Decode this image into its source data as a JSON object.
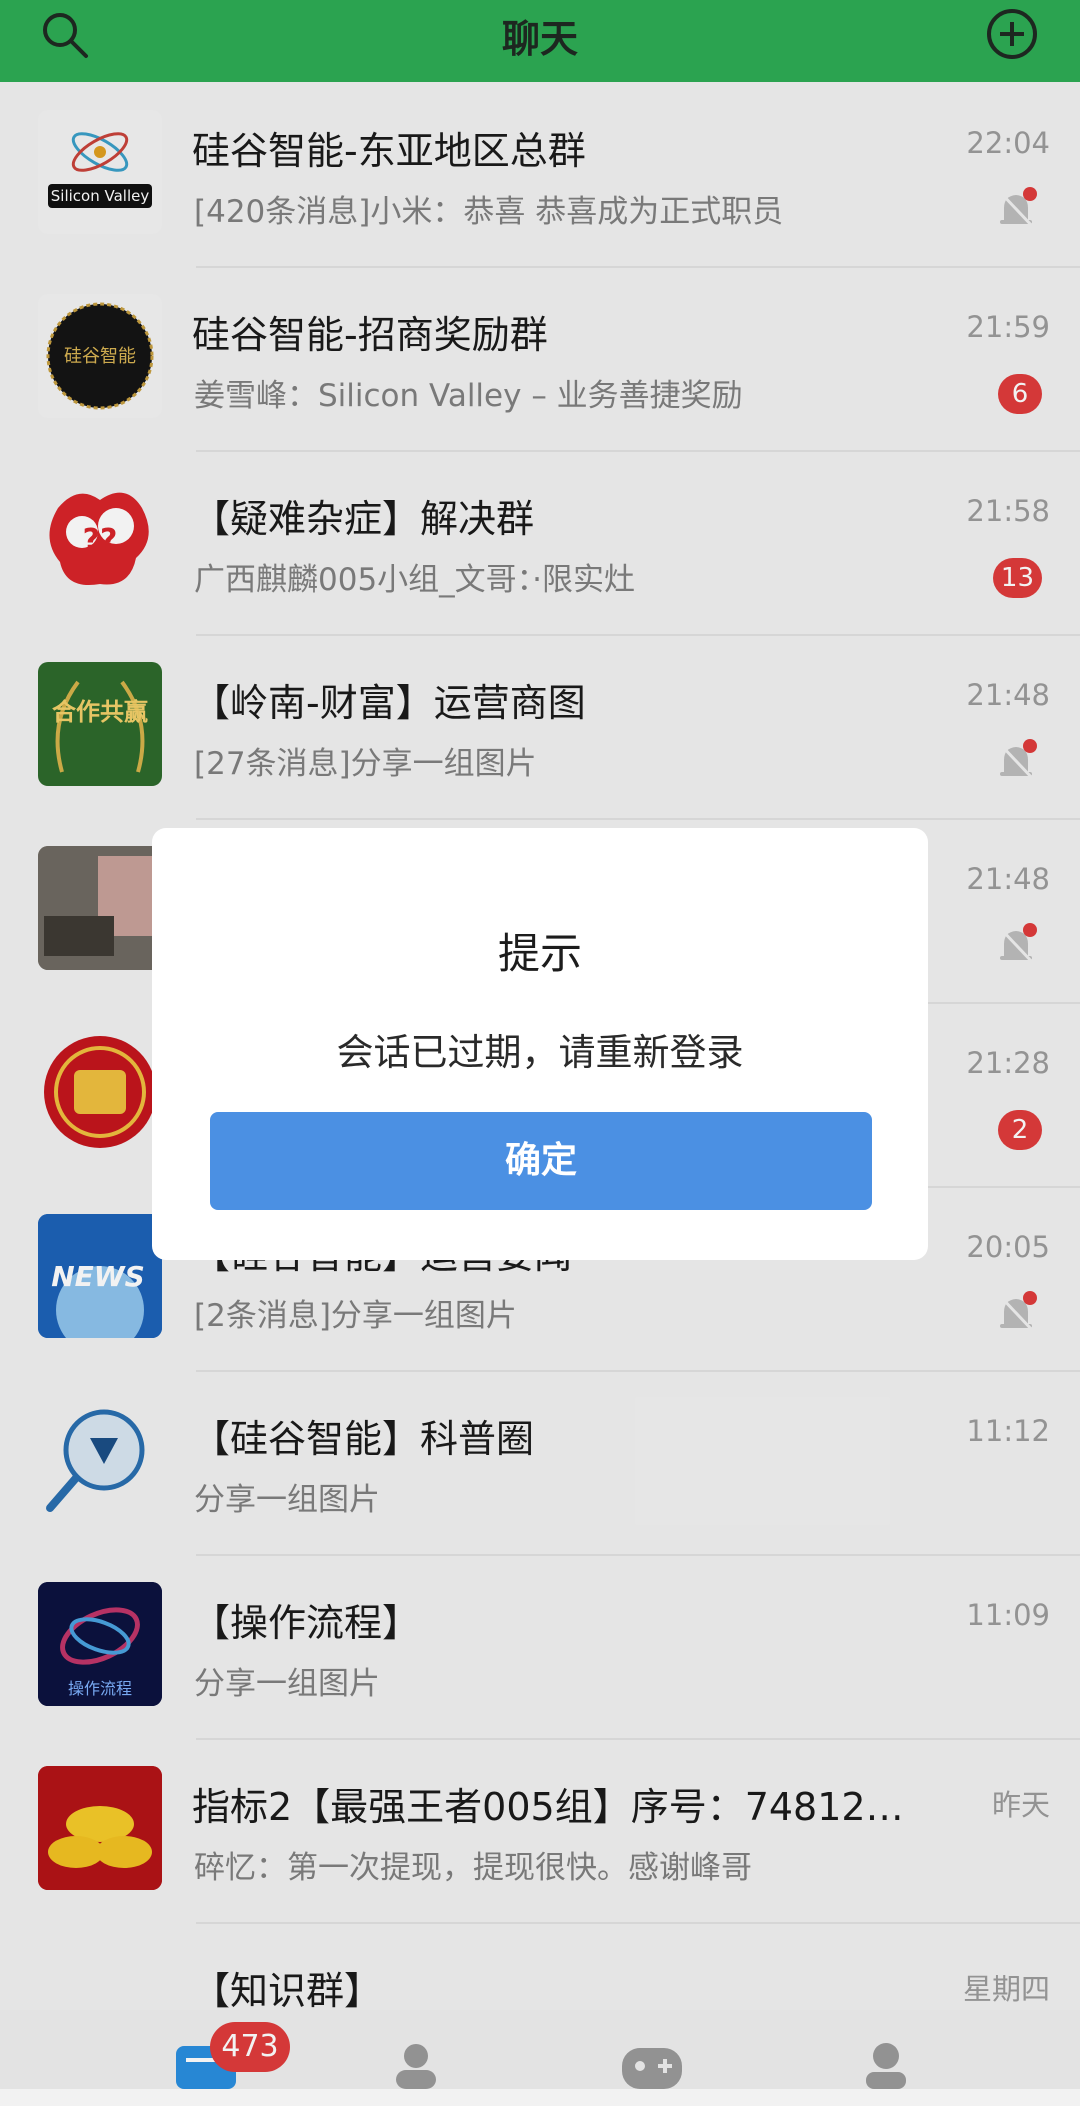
{
  "header": {
    "title": "聊天"
  },
  "chats": [
    {
      "name": "硅谷智能-东亚地区总群",
      "message": "[420条消息]小米：恭喜 恭喜成为正式职员",
      "time": "22:04",
      "badge": "",
      "muted": true,
      "avatar_text": "Silicon Valley"
    },
    {
      "name": "硅谷智能-招商奖励群",
      "message": "姜雪峰：Silicon Valley – 业务善捷奖励",
      "time": "21:59",
      "badge": "6",
      "muted": false,
      "avatar_text": "硅谷智能"
    },
    {
      "name": "【疑难杂症】解决群",
      "message": "广西麒麟005小组_文哥：·限实灶",
      "time": "21:58",
      "badge": "13",
      "muted": false,
      "avatar_text": "??"
    },
    {
      "name": "【岭南-财富】运营商图",
      "message": "[27条消息]分享一组图片",
      "time": "21:48",
      "badge": "",
      "muted": true,
      "avatar_text": "合作共赢"
    },
    {
      "name": "",
      "message": "",
      "time": "21:48",
      "badge": "",
      "muted": true,
      "avatar_text": ""
    },
    {
      "name": "",
      "message": "",
      "time": "21:28",
      "badge": "2",
      "muted": false,
      "avatar_text": ""
    },
    {
      "name": "【硅谷智能】运营要闻",
      "message": "[2条消息]分享一组图片",
      "time": "20:05",
      "badge": "",
      "muted": true,
      "avatar_text": "NEWS"
    },
    {
      "name": "【硅谷智能】科普圈",
      "message": "分享一组图片",
      "time": "11:12",
      "badge": "",
      "muted": false,
      "avatar_text": ""
    },
    {
      "name": "【操作流程】",
      "message": "分享一组图片",
      "time": "11:09",
      "badge": "",
      "muted": false,
      "avatar_text": "操作流程"
    },
    {
      "name": "指标2【最强王者005组】序号：74812…",
      "message": "碎忆：第一次提现，提现很快。感谢峰哥",
      "time": "昨天",
      "badge": "",
      "muted": false,
      "avatar_text": ""
    },
    {
      "name": "【知识群】",
      "message": "",
      "time": "星期四",
      "badge": "",
      "muted": false,
      "avatar_text": ""
    }
  ],
  "dialog": {
    "title": "提示",
    "message": "会话已过期，请重新登录",
    "confirm_label": "确定"
  },
  "tabbar": {
    "chats_badge": "473"
  },
  "colors": {
    "header_green": "#2eac55",
    "badge_red": "#e03b3b",
    "button_blue": "#4b90e3"
  }
}
